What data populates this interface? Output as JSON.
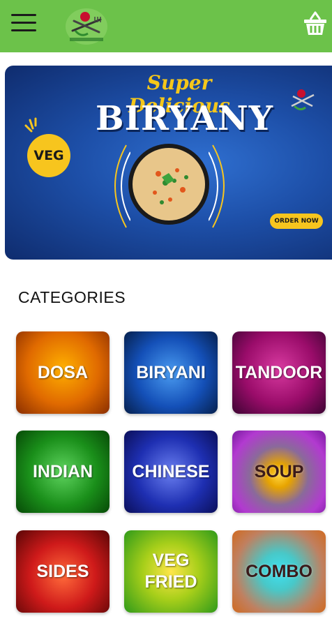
{
  "header": {
    "menu_icon": "hamburger-menu-icon",
    "logo_icon": "restaurant-logo-fork-knife",
    "cart_icon": "shopping-basket-icon",
    "background_color": "#6cc24a"
  },
  "banner": {
    "superline": "Super Delicious",
    "title": "BIRYANY",
    "badge": "VEG",
    "cta": "ORDER NOW",
    "accent_color": "#f7c51e"
  },
  "categories": {
    "heading": "CATEGORIES",
    "items": [
      {
        "label": "DOSA"
      },
      {
        "label": "BIRYANI"
      },
      {
        "label": "TANDOOR"
      },
      {
        "label": "INDIAN"
      },
      {
        "label": "CHINESE"
      },
      {
        "label": "SOUP"
      },
      {
        "label": "SIDES"
      },
      {
        "label": "VEG FRIED"
      },
      {
        "label": "COMBO"
      }
    ]
  }
}
